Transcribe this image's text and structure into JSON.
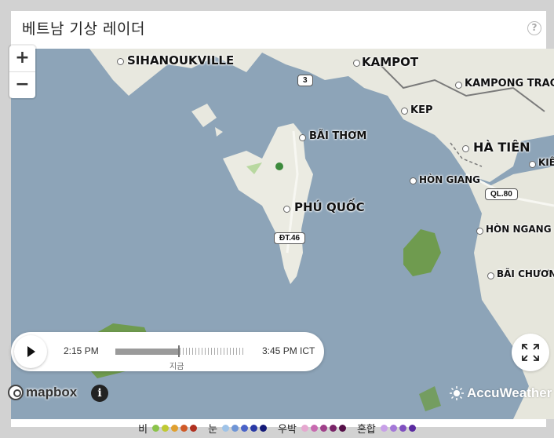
{
  "widget": {
    "title": "베트남 기상 레이더",
    "help_label": "?"
  },
  "zoom": {
    "in_label": "+",
    "out_label": "−"
  },
  "map_labels": [
    {
      "id": "sihanoukville",
      "text": "SIHANOUKVILLE"
    },
    {
      "id": "kampot",
      "text": "KAMPOT"
    },
    {
      "id": "kampong-trach",
      "text": "KAMPONG TRACH"
    },
    {
      "id": "kep",
      "text": "KEP"
    },
    {
      "id": "bai-thom",
      "text": "BÃI THƠM"
    },
    {
      "id": "ha-tien",
      "text": "HÀ TIÊN"
    },
    {
      "id": "kien",
      "text": "KIÊN T"
    },
    {
      "id": "hon-giang",
      "text": "HÒN GIANG"
    },
    {
      "id": "phu-quoc",
      "text": "PHÚ QUỐC"
    },
    {
      "id": "hon-ngang",
      "text": "HÒN NGANG"
    },
    {
      "id": "bai-chuong",
      "text": "BÃI CHƯƠNG"
    }
  ],
  "road_shields": [
    {
      "id": "route-3",
      "text": "3"
    },
    {
      "id": "ql-80",
      "text": "QL.80"
    },
    {
      "id": "dt-46",
      "text": "ĐT.46"
    }
  ],
  "player": {
    "start_time": "2:15 PM",
    "end_time": "3:45 PM ICT",
    "now_label": "지금",
    "progress": 0.48
  },
  "attribution": {
    "mapbox": "mapbox",
    "info": "i",
    "accuweather": "AccuWeather"
  },
  "legend": [
    {
      "label": "비",
      "colors": [
        "#8bc34a",
        "#c0ca33",
        "#e0a030",
        "#d05a28",
        "#b03020"
      ]
    },
    {
      "label": "눈",
      "colors": [
        "#9fc3e8",
        "#6f95d6",
        "#4a63c8",
        "#2a3aa6",
        "#141a78"
      ]
    },
    {
      "label": "우박",
      "colors": [
        "#e6a8d0",
        "#c86ab0",
        "#a0408a",
        "#7a2468",
        "#561048"
      ]
    },
    {
      "label": "혼합",
      "colors": [
        "#c8a0e8",
        "#a478d8",
        "#8050c0",
        "#5a2aa0"
      ]
    }
  ]
}
